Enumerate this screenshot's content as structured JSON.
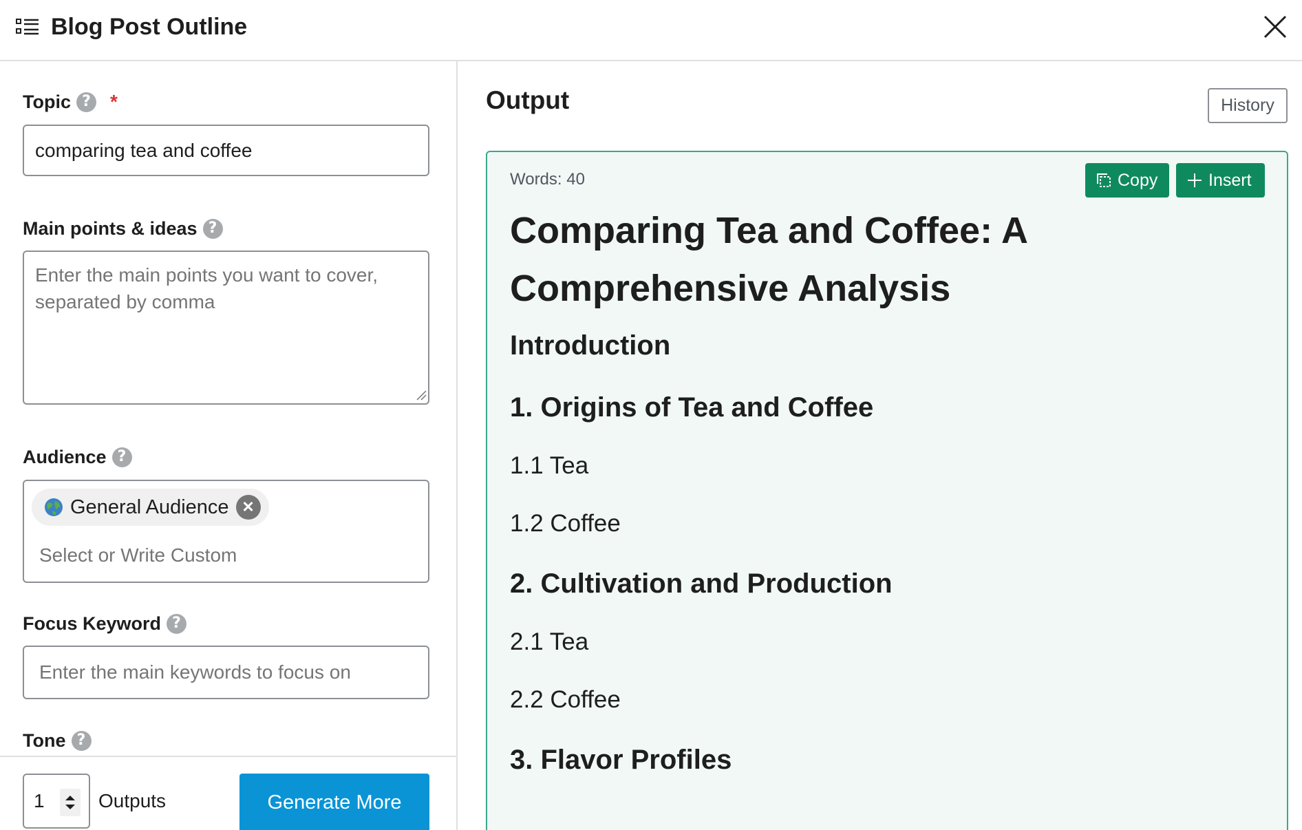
{
  "header": {
    "title": "Blog Post Outline",
    "icon": "list-icon",
    "close_icon": "close-icon"
  },
  "form": {
    "topic": {
      "label": "Topic",
      "required_mark": "*",
      "value": "comparing tea and coffee"
    },
    "main_points": {
      "label": "Main points & ideas",
      "placeholder": "Enter the main points you want to cover, separated by comma"
    },
    "audience": {
      "label": "Audience",
      "selected_token": "General Audience",
      "placeholder": "Select or Write Custom"
    },
    "focus_keyword": {
      "label": "Focus Keyword",
      "placeholder": "Enter the main keywords to focus on"
    },
    "tone": {
      "label": "Tone"
    },
    "help_glyph": "?"
  },
  "footer": {
    "outputs_count": "1",
    "outputs_label": "Outputs",
    "generate_label": "Generate More"
  },
  "output": {
    "title": "Output",
    "history_label": "History",
    "words": "Words: 40",
    "copy_label": "Copy",
    "insert_label": "Insert",
    "outline_title": "Comparing Tea and Coffee: A Comprehensive Analysis",
    "sections": [
      {
        "level": "h2",
        "text": "Introduction"
      },
      {
        "level": "h2",
        "text": "1. Origins of Tea and Coffee"
      },
      {
        "level": "h3",
        "text": "1.1 Tea"
      },
      {
        "level": "h3",
        "text": "1.2 Coffee"
      },
      {
        "level": "h2",
        "text": "2. Cultivation and Production"
      },
      {
        "level": "h3",
        "text": "2.1 Tea"
      },
      {
        "level": "h3",
        "text": "2.2 Coffee"
      },
      {
        "level": "h2",
        "text": "3. Flavor Profiles"
      }
    ]
  },
  "colors": {
    "accent_green": "#0f8a5f",
    "card_border": "#3aa88c",
    "card_bg": "#f1f8f6",
    "primary_blue": "#0a94d6",
    "required_red": "#d63638"
  }
}
